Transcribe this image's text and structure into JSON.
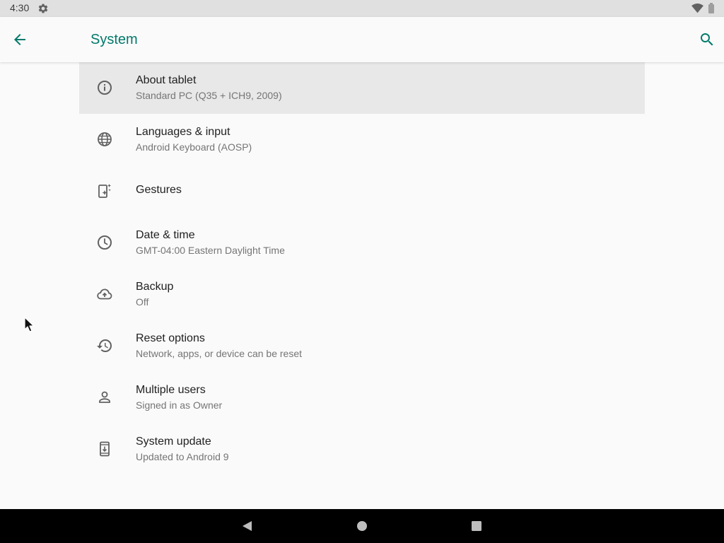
{
  "status_bar": {
    "time": "4:30",
    "icons": [
      "gear-icon",
      "wifi-icon",
      "battery-icon"
    ]
  },
  "app_bar": {
    "title": "System",
    "back_icon": "arrow-back-icon",
    "search_icon": "search-icon"
  },
  "settings": [
    {
      "title": "About tablet",
      "summary": "Standard PC (Q35 + ICH9, 2009)",
      "icon": "info-icon",
      "highlighted": true
    },
    {
      "title": "Languages & input",
      "summary": "Android Keyboard (AOSP)",
      "icon": "globe-icon"
    },
    {
      "title": "Gestures",
      "summary": "",
      "icon": "gestures-phone-icon"
    },
    {
      "title": "Date & time",
      "summary": "GMT-04:00 Eastern Daylight Time",
      "icon": "clock-icon"
    },
    {
      "title": "Backup",
      "summary": "Off",
      "icon": "cloud-upload-icon"
    },
    {
      "title": "Reset options",
      "summary": "Network, apps, or device can be reset",
      "icon": "history-icon"
    },
    {
      "title": "Multiple users",
      "summary": "Signed in as Owner",
      "icon": "person-icon"
    },
    {
      "title": "System update",
      "summary": "Updated to Android 9",
      "icon": "system-update-icon"
    }
  ],
  "nav_bar": {
    "icons": [
      "nav-back-icon",
      "nav-home-icon",
      "nav-recents-icon"
    ]
  },
  "colors": {
    "accent": "#00796b",
    "background": "#fafafa",
    "status_bar": "#e0e0e0",
    "highlight": "#e8e8e8",
    "nav_bar": "#000000"
  }
}
